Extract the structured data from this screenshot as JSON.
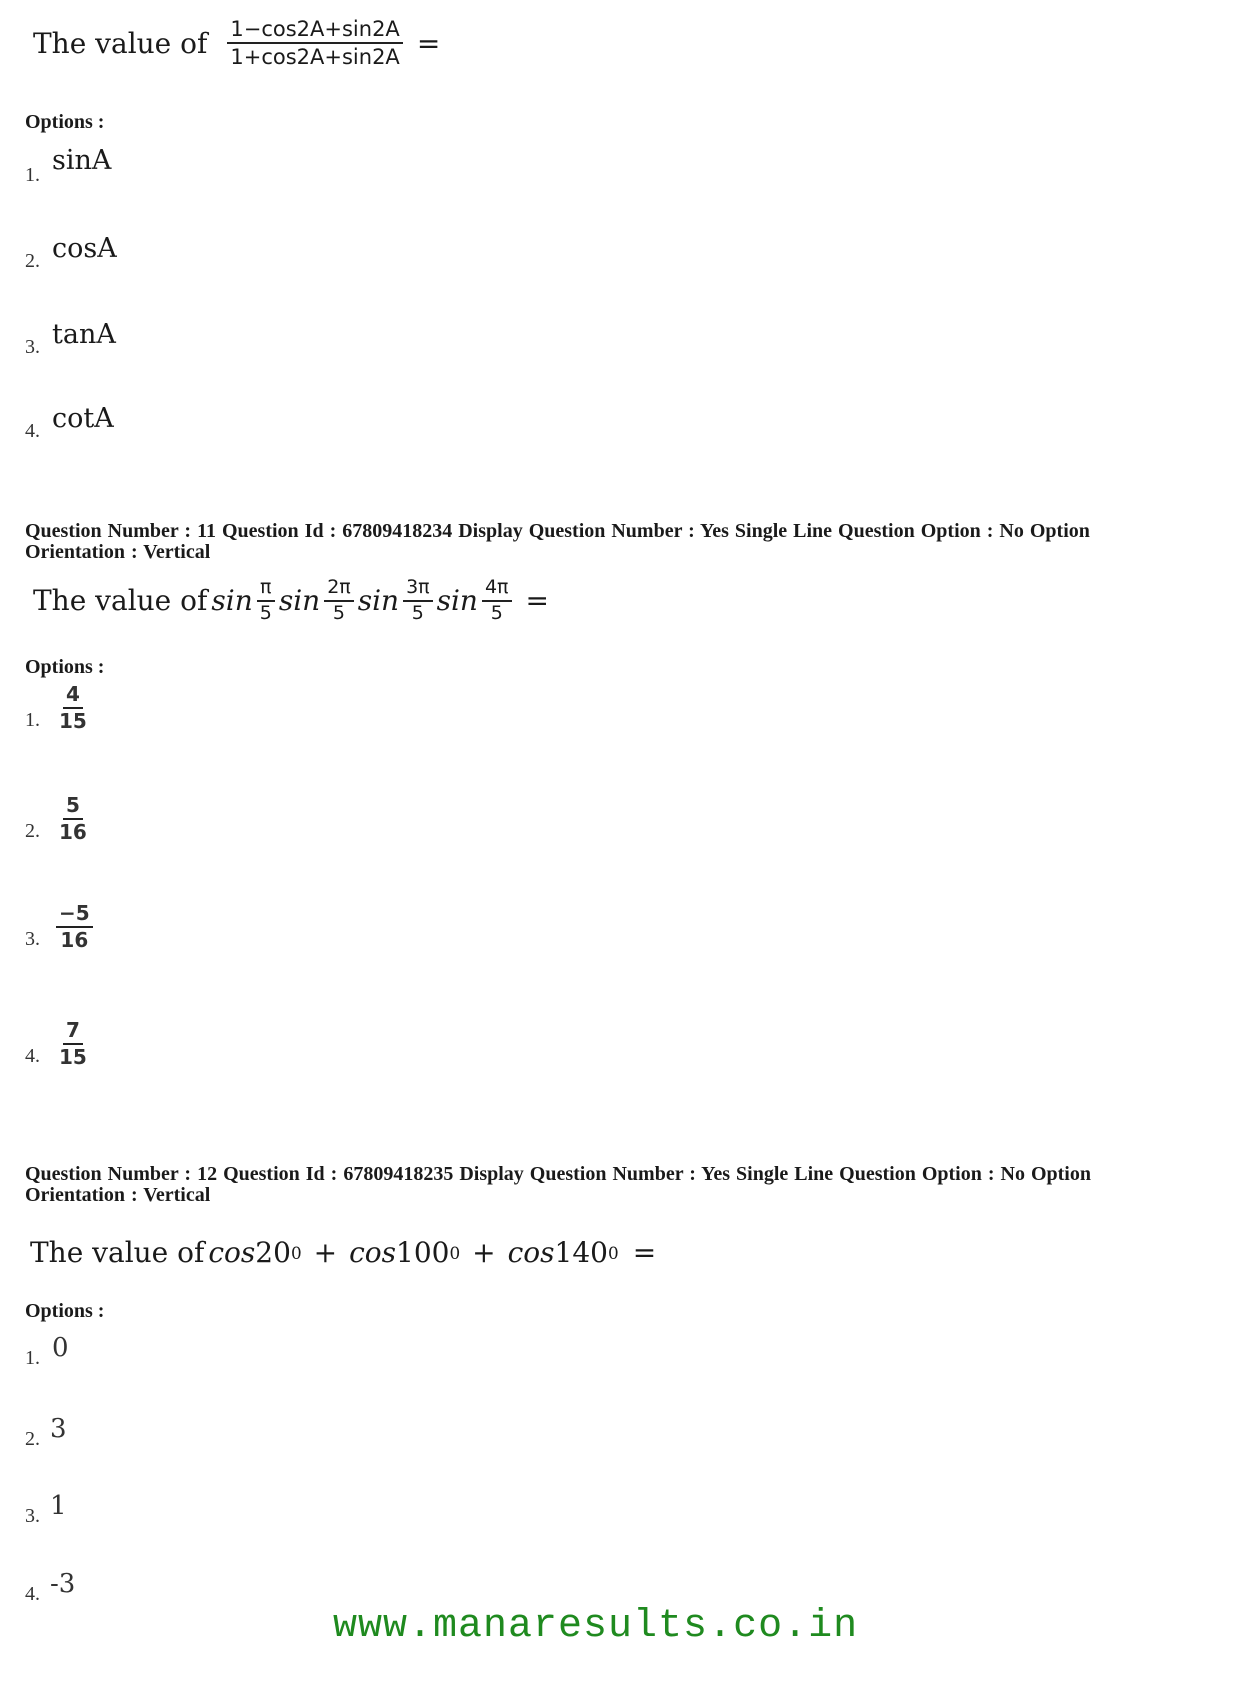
{
  "questions": [
    {
      "meta": null,
      "stem": {
        "prefix": "The value of",
        "numerator": "1−cos2A+sin2A",
        "denominator": "1+cos2A+sin2A",
        "suffix": "="
      },
      "options_label": "Options :",
      "options": [
        {
          "num": "1.",
          "value": "sinA"
        },
        {
          "num": "2.",
          "value": "cosA"
        },
        {
          "num": "3.",
          "value": "tanA"
        },
        {
          "num": "4.",
          "value": "cotA"
        }
      ]
    },
    {
      "meta": "Question Number : 11  Question Id : 67809418234  Display Question Number : Yes  Single Line Question Option : No  Option Orientation : Vertical",
      "stem": {
        "prefix": "The value of",
        "terms": [
          {
            "fn": "sin",
            "num": "π",
            "den": "5"
          },
          {
            "fn": "sin",
            "num": "2π",
            "den": "5"
          },
          {
            "fn": "sin",
            "num": "3π",
            "den": "5"
          },
          {
            "fn": "sin",
            "num": "4π",
            "den": "5"
          }
        ],
        "suffix": "="
      },
      "options_label": "Options :",
      "options": [
        {
          "num": "1.",
          "numerator": "4",
          "denominator": "15"
        },
        {
          "num": "2.",
          "numerator": "5",
          "denominator": "16"
        },
        {
          "num": "3.",
          "numerator": "−5",
          "denominator": "16"
        },
        {
          "num": "4.",
          "numerator": "7",
          "denominator": "15"
        }
      ]
    },
    {
      "meta": "Question Number : 12  Question Id : 67809418235  Display Question Number : Yes  Single Line Question Option : No  Option Orientation : Vertical",
      "stem": {
        "prefix": "The value of",
        "terms": [
          {
            "fn": "cos",
            "angle": "20",
            "sup": "0"
          },
          {
            "fn": "cos",
            "angle": "100",
            "sup": "0"
          },
          {
            "fn": "cos",
            "angle": "140",
            "sup": "0"
          }
        ],
        "joiner": "+",
        "suffix": "="
      },
      "options_label": "Options :",
      "options": [
        {
          "num": "1.",
          "value": "0"
        },
        {
          "num": "2.",
          "value": "3"
        },
        {
          "num": "3.",
          "value": "1"
        },
        {
          "num": "4.",
          "value": "-3"
        }
      ]
    }
  ],
  "footer": {
    "watermark": "www.manaresults.co.in",
    "color": "#1f8a1f"
  }
}
